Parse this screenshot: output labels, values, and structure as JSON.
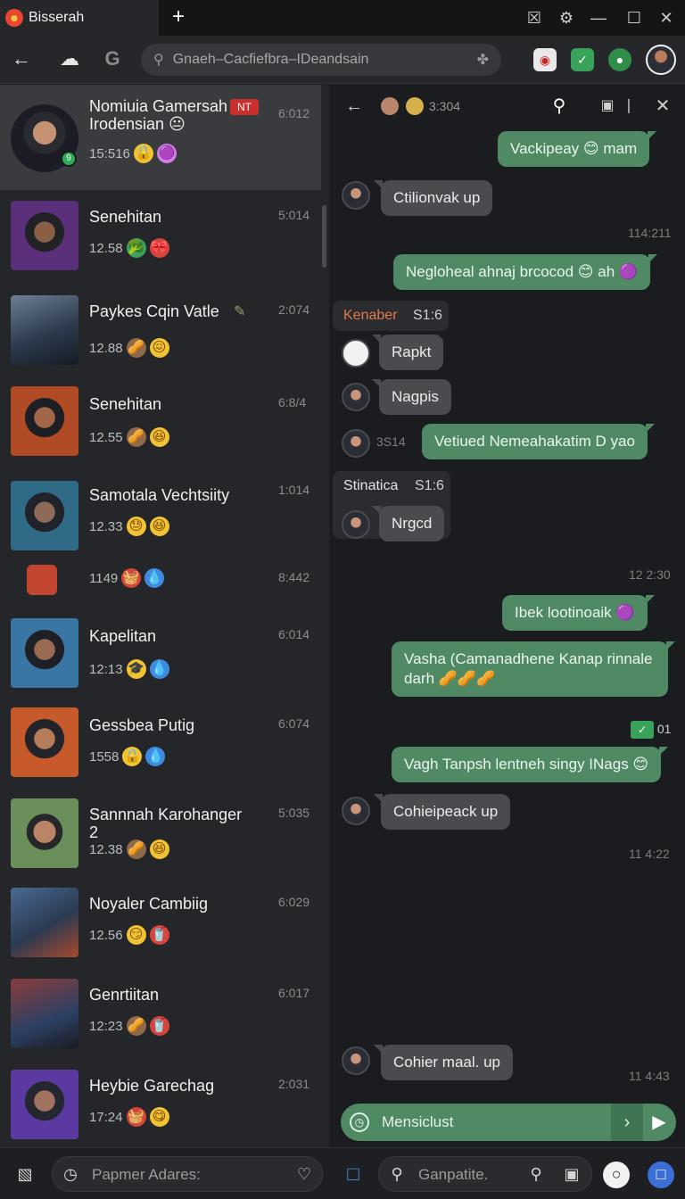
{
  "browser": {
    "tab_title": "Bisserah",
    "address": "Gnaeh–Cacfiefbra–IDeandsain",
    "window_controls": [
      "close-x-box",
      "translate",
      "minimize",
      "maximize",
      "close"
    ]
  },
  "sidebar": {
    "chats": [
      {
        "name": "Nomiuia Gamersah Irodensian 😐",
        "badge": "NT",
        "time": "6:012",
        "meta": "15:516",
        "emojis": [
          "🔒",
          "🟣"
        ]
      },
      {
        "name": "Senehitan",
        "time": "5:014",
        "meta": "12.58",
        "emojis": [
          "🥦",
          "🎀"
        ]
      },
      {
        "name": "Paykes Cqin Vatle",
        "time": "2:074",
        "meta": "12.88",
        "emojis": [
          "🥜",
          "😖"
        ]
      },
      {
        "name": "Senehitan",
        "time": "6:8/4",
        "meta": "12.55",
        "emojis": [
          "🥜",
          "😆"
        ]
      },
      {
        "name": "Samotala Vechtsiity",
        "time": "1:014",
        "meta": "12.33",
        "emojis": [
          "😓",
          "😆"
        ]
      },
      {
        "name": "",
        "time": "8:442",
        "meta": "1149",
        "emojis": [
          "🧺",
          "💧"
        ]
      },
      {
        "name": "Kapelitan",
        "time": "6:014",
        "meta": "12:13",
        "emojis": [
          "🎓",
          "💧"
        ]
      },
      {
        "name": "Gessbea Putig",
        "time": "6:074",
        "meta": "1558",
        "emojis": [
          "🔒",
          "💧"
        ]
      },
      {
        "name": "Sannnah Karohanger 2",
        "time": "5:035",
        "meta": "12.38",
        "emojis": [
          "🥜",
          "😆"
        ]
      },
      {
        "name": "Noyaler Cambiig",
        "time": "6:029",
        "meta": "12.56",
        "emojis": [
          "😏",
          "🥤"
        ]
      },
      {
        "name": "Genrtiitan",
        "time": "6:017",
        "meta": "12:23",
        "emojis": [
          "🥜",
          "🥤"
        ]
      },
      {
        "name": "Heybie Garechag",
        "time": "2:031",
        "meta": "17:24",
        "emojis": [
          "🧺",
          "😋"
        ]
      }
    ]
  },
  "chat": {
    "header_status": "3:304",
    "messages": [
      {
        "dir": "out",
        "text": "Vackipeay 😊 mam"
      },
      {
        "dir": "in",
        "text": "Ctilionvak up"
      },
      {
        "dir": "stamp",
        "text": "114:211"
      },
      {
        "dir": "out",
        "text": "Negloheal ahnaj brcocod 😊 ah 🟣"
      },
      {
        "dir": "group",
        "label": "Kenaber",
        "count": "S1:6"
      },
      {
        "dir": "in",
        "text": "Rapkt"
      },
      {
        "dir": "in",
        "text": "Nagpis"
      },
      {
        "dir": "stamp",
        "text": "3S14"
      },
      {
        "dir": "out",
        "text": "Vetiued Nemeahakatim D yao"
      },
      {
        "dir": "group",
        "label": "Stinatica",
        "count": "S1:6"
      },
      {
        "dir": "in",
        "text": "Nrgcd"
      },
      {
        "dir": "stamp",
        "text": "12 2:30"
      },
      {
        "dir": "out",
        "text": "Ibek lootinoaik 🟣"
      },
      {
        "dir": "out",
        "text": "Vasha (Camanadhene Kanap rinnale darh 🥜🥜🥜"
      },
      {
        "dir": "stamp",
        "text": "01"
      },
      {
        "dir": "out",
        "text": "Vagh Tanpsh lentneh singy INags 😊"
      },
      {
        "dir": "in",
        "text": "Cohieipeack up"
      },
      {
        "dir": "stamp",
        "text": "11 4:22"
      },
      {
        "dir": "in",
        "text": "Cohier maal. up"
      },
      {
        "dir": "stamp",
        "text": "11 4:43"
      }
    ],
    "composer_placeholder": "Mensiclust"
  },
  "bottombar": {
    "left_placeholder": "Papmer Adares:",
    "right_placeholder": "Ganpatite."
  },
  "colors": {
    "bubble_out": "#4f8a64",
    "bubble_in": "#4a4b4f",
    "sidebar_bg": "#252629",
    "chat_bg": "#1b1c1f"
  }
}
